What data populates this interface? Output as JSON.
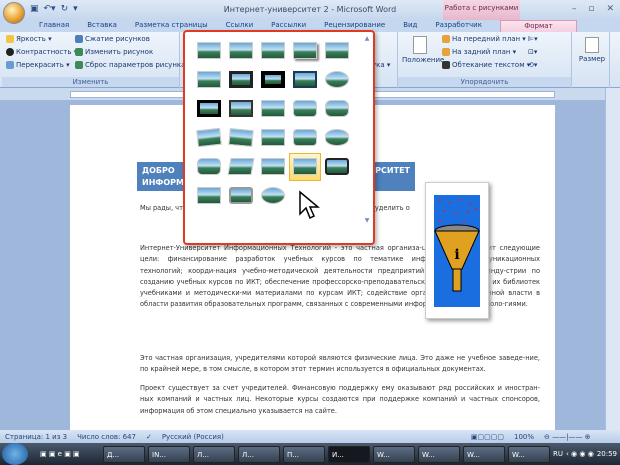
{
  "window": {
    "title": "Интернет-университет 2 - Microsoft Word",
    "context_tab": "Работа с рисунками"
  },
  "tabs": [
    "Главная",
    "Вставка",
    "Разметка страницы",
    "Ссылки",
    "Рассылки",
    "Рецензирование",
    "Вид",
    "Разработчик",
    "Формат"
  ],
  "ribbon": {
    "adjust": {
      "label": "Изменить",
      "items": [
        "Яркость ▾",
        "Контрастность ▾",
        "Перекрасить ▾",
        "Сжатие рисунков",
        "Изменить рисунок",
        "Сброс параметров рисунка"
      ]
    },
    "arrange": {
      "label": "Упорядочить",
      "position": "Положение",
      "items": [
        "На передний план ▾",
        "На задний план ▾",
        "Обтекание текстом ▾"
      ]
    },
    "size": {
      "label": "Размер"
    },
    "partial": "ука ▾"
  },
  "gallery": {
    "rows": 6,
    "cols": 5,
    "count": 28,
    "selected_index": 23
  },
  "document": {
    "heading": [
      "ДОБРО",
      "ИНФОРМ",
      "ИВЕРСИТЕТ"
    ],
    "paragraphs": [
      "Мы рады, что ... компьютерных технологий ... которые Вы гото-вы уделить о",
      "Интернет-Университет Информационных Технологий - это частная организа-ция, которая ставит следующие цели:  финансирование разработок учебных курсов по тематике информационно-коммуникационных технологий; коорди-нация учебно-методической деятельности предприятий компьютерной инду-стрии по созданию учебных курсов по ИКТ; обеспечение профессорско-преподавательских кадров вузов и их библиотек учебниками и методически-ми материалами по курсам ИКТ; содействие органам государственной власти в области развития образовательных программ, связанных с современными информационными техноло-гиями.",
      "Это частная организация, учредителями которой являются физические лица. Это даже не учебное заведе-ние, по крайней мере, в том смысле, в котором этот термин используется в официальных документах.",
      "Проект существует за счет учредителей. Финансовую поддержку ему оказывают ряд российских и иностран-ных компаний и частных лиц. Некоторые курсы создаются при поддержке компаний и частных спонсоров, информация об этом специально указывается на сайте."
    ]
  },
  "status": {
    "page": "Страница: 1 из 3",
    "words": "Число слов: 647",
    "language": "Русский (Россия)",
    "zoom": "100%"
  },
  "taskbar": {
    "items": [
      "Д...",
      "IN...",
      "Л...",
      "Л...",
      "П...",
      "И...",
      "W...",
      "W...",
      "W...",
      "W..."
    ],
    "lang": "RU",
    "clock": "20:59"
  }
}
